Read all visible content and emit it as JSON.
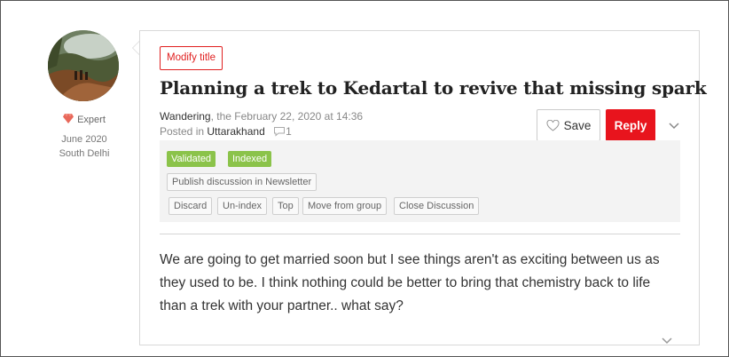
{
  "author": {
    "rank": "Expert",
    "member_since": "June 2020",
    "location": "South Delhi",
    "gem_color": "#e8685a"
  },
  "post": {
    "modify_title_label": "Modify title",
    "title": "Planning a trek to Kedartal to revive that missing spark",
    "author_name": "Wandering",
    "date_text": ", the February 22, 2020 at 14:36",
    "posted_in_prefix": "Posted in ",
    "region": "Uttarakhand",
    "comment_count": "1",
    "save_label": "Save",
    "reply_label": "Reply",
    "body": "We are going to get married soon but I see things aren't as exciting between us as they used to be. I think nothing could be better to bring that chemistry back to life than a trek with your partner.. what say?"
  },
  "admin": {
    "badges": [
      "Validated",
      "Indexed"
    ],
    "publish_label": "Publish discussion in Newsletter",
    "tools": [
      "Discard",
      "Un-index",
      "Top",
      "Move from group",
      "Close Discussion"
    ]
  },
  "colors": {
    "accent": "#e8141d",
    "badge_green": "#8bc34a"
  }
}
